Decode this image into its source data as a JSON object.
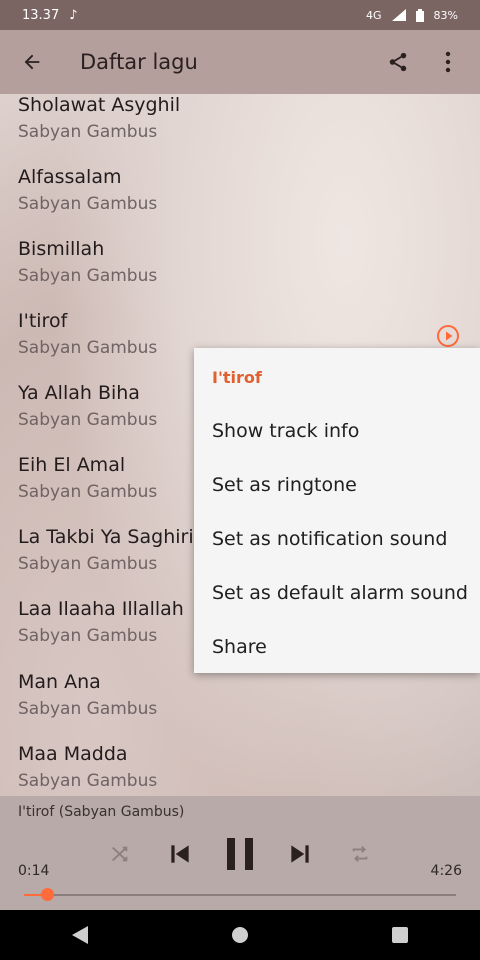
{
  "status_bar": {
    "time": "13.37",
    "network": "4G",
    "battery": "83%"
  },
  "app_bar": {
    "title": "Daftar lagu",
    "back_icon": "arrow-left-icon",
    "share_icon": "share-icon",
    "more_icon": "more-vert-icon"
  },
  "songs": [
    {
      "title": "Sholawat Asyghil",
      "artist": "Sabyan Gambus"
    },
    {
      "title": "Alfassalam",
      "artist": "Sabyan Gambus"
    },
    {
      "title": "Bismillah",
      "artist": "Sabyan Gambus"
    },
    {
      "title": "I'tirof",
      "artist": "Sabyan Gambus"
    },
    {
      "title": "Ya Allah Biha",
      "artist": "Sabyan Gambus"
    },
    {
      "title": "Eih El Amal",
      "artist": "Sabyan Gambus"
    },
    {
      "title": "La Takbi Ya Saghiri",
      "artist": "Sabyan Gambus"
    },
    {
      "title": "Laa Ilaaha Illallah",
      "artist": "Sabyan Gambus"
    },
    {
      "title": "Man Ana",
      "artist": "Sabyan Gambus"
    },
    {
      "title": "Maa Madda",
      "artist": "Sabyan Gambus"
    }
  ],
  "context_menu": {
    "header": "I'tirof",
    "items": [
      "Show track info",
      "Set as ringtone",
      "Set as notification sound",
      "Set as default alarm sound",
      "Share"
    ]
  },
  "player": {
    "now_playing": "I'tirof (Sabyan Gambus)",
    "elapsed": "0:14",
    "duration": "4:26",
    "progress_fraction": 0.053
  },
  "colors": {
    "accent": "#ff6b3a",
    "menu_header": "#e06030"
  }
}
